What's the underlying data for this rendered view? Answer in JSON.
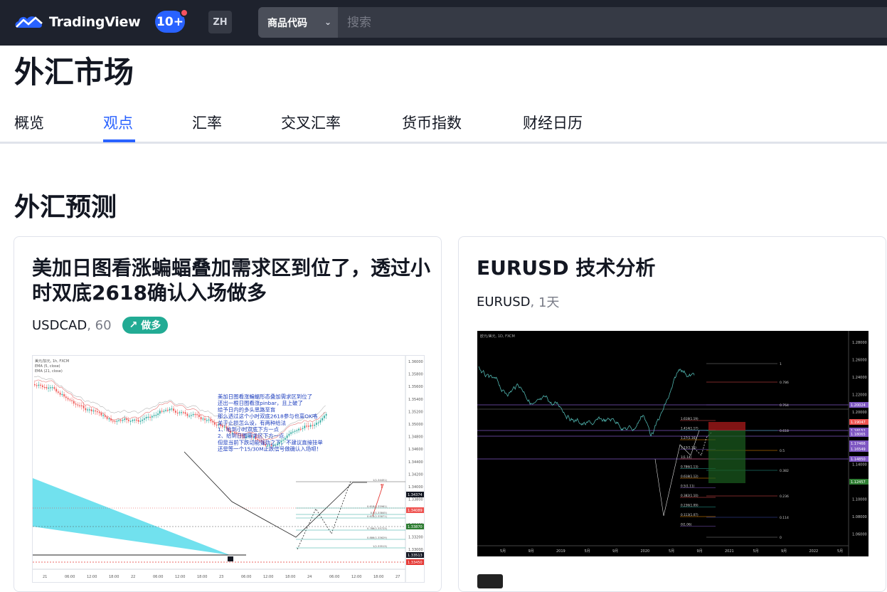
{
  "header": {
    "brand": "TradingView",
    "notifications": "10+",
    "language": "ZH",
    "search_type": "商品代码",
    "search_placeholder": "搜索"
  },
  "page": {
    "title": "外汇市场",
    "tabs": [
      {
        "label": "概览",
        "active": false
      },
      {
        "label": "观点",
        "active": true
      },
      {
        "label": "汇率",
        "active": false
      },
      {
        "label": "交叉汇率",
        "active": false
      },
      {
        "label": "货币指数",
        "active": false
      },
      {
        "label": "财经日历",
        "active": false
      }
    ],
    "section_title": "外汇预测"
  },
  "ideas": [
    {
      "title": "美加日图看涨蝙蝠叠加需求区到位了，透过小时双底2618确认入场做多",
      "symbol": "USDCAD",
      "interval": "60",
      "direction": "做多",
      "chart": {
        "header_lines": [
          "美元/加元, 1h, FXCM",
          "EMA (5, close)",
          "EMA (21, close)"
        ],
        "annotation": [
          "美加日图看涨蝙蝠形态叠加需求区到位了",
          "还出一根日图看涨pinbar，且上破了",
          "给予日内的多头思路至盲",
          "那么透过这个小时双底2618参与也蛮OK咯",
          "关于止损怎么设，有两种给法",
          "1、给到小时双底下方一点",
          "2、给到日图需求区下方一点",
          "但是当前下跌动能强劲之下，不建议直接挂单",
          "还是等一个15/30M止跌信号做确认入场吧！"
        ],
        "price_ticks": [
          "1.36000",
          "1.35800",
          "1.35600",
          "1.35400",
          "1.35200",
          "1.35000",
          "1.34800",
          "1.34600",
          "1.34400",
          "1.34200",
          "1.34000",
          "1.33800",
          "1.33600",
          "1.33400",
          "1.33200",
          "1.33000"
        ],
        "price_tags": [
          "1.34374",
          "1.34089",
          "1.33870",
          "1.33513",
          "1.33450"
        ],
        "fib_labels": [
          "1(1.34451)",
          "0.618(1.33961)",
          "0.5(1.33845)",
          "0.618(1.33871)",
          "0.786(1.33723)",
          "0.886(1.33629)",
          "1(1.33513)"
        ],
        "time_ticks": [
          "21",
          "06:00",
          "12:00",
          "18:00",
          "22",
          "06:00",
          "12:00",
          "18:00",
          "23",
          "06:00",
          "12:00",
          "18:00",
          "24",
          "06:00",
          "12:00",
          "18:00",
          "27"
        ]
      }
    },
    {
      "title": "EURUSD 技术分析",
      "symbol": "EURUSD",
      "interval": "1天",
      "chart": {
        "header_line": "欧元/美元, 1D, FXCM",
        "price_ticks": [
          "1.28000",
          "1.26000",
          "1.24000",
          "1.22000",
          "1.20000",
          "1.18000",
          "1.16000",
          "1.14000",
          "1.12000",
          "1.10000",
          "1.08000",
          "1.06000"
        ],
        "price_tags": [
          "1.20024",
          "1.19047",
          "1.18152",
          "1.18065",
          "1.17466",
          "1.16549",
          "1.14850",
          "1.12457"
        ],
        "fib_right": [
          "1",
          "0.786",
          "0.764",
          "0.618",
          "0.5",
          "0.382",
          "0.236",
          "0.114",
          "0"
        ],
        "fib_left": [
          "1.618(1.19)",
          "1.414(1.17)",
          "1.27(1.16)",
          "1.13(1.15)",
          "1(1.14)",
          "0.786(1.13)",
          "0.618(1.12)",
          "0.5(1.11)",
          "0.382(1.10)",
          "0.236(1.09)",
          "0.113(1.07)",
          "0(1.06)"
        ],
        "time_ticks": [
          "5月",
          "9月",
          "2019",
          "5月",
          "9月",
          "2020",
          "5月",
          "9月",
          "2021",
          "5月",
          "9月",
          "2022",
          "5月"
        ]
      }
    }
  ],
  "colors": {
    "accent": "#2962ff",
    "long": "#22ab94",
    "bar_bg": "#1e222d"
  }
}
